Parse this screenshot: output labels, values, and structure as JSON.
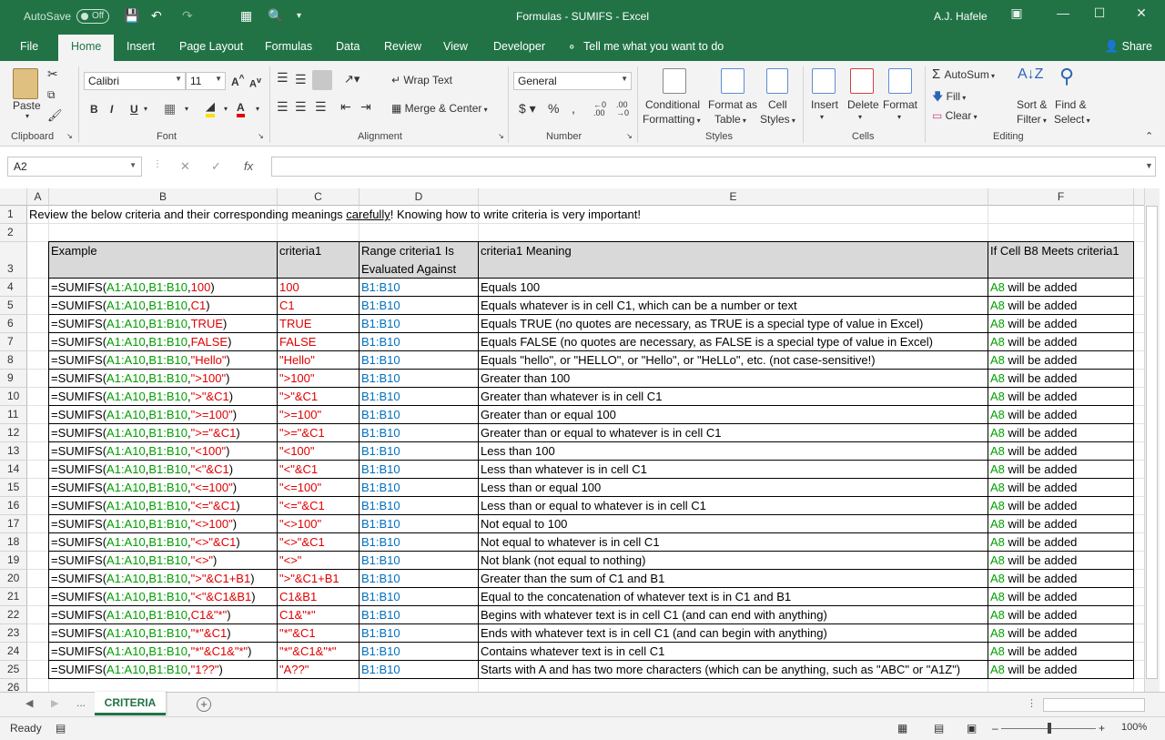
{
  "titlebar": {
    "autosave_label": "AutoSave",
    "autosave_state": "Off",
    "title": "Formulas - SUMIFS  -  Excel",
    "user": "A.J. Hafele"
  },
  "tabs": [
    "File",
    "Home",
    "Insert",
    "Page Layout",
    "Formulas",
    "Data",
    "Review",
    "View",
    "Developer",
    "Tell me what you want to do"
  ],
  "active_tab": "Home",
  "share": "Share",
  "ribbon": {
    "clipboard": {
      "paste": "Paste",
      "label": "Clipboard"
    },
    "font": {
      "name": "Calibri",
      "size": "11",
      "label": "Font"
    },
    "alignment": {
      "wrap": "Wrap Text",
      "merge": "Merge & Center",
      "label": "Alignment"
    },
    "number": {
      "format": "General",
      "label": "Number"
    },
    "styles": {
      "conditional": "Conditional",
      "formatting": "Formatting",
      "format_as": "Format as",
      "table": "Table",
      "cell": "Cell",
      "styles": "Styles",
      "label": "Styles"
    },
    "cells": {
      "insert": "Insert",
      "delete": "Delete",
      "format": "Format",
      "label": "Cells"
    },
    "editing": {
      "autosum": "AutoSum",
      "fill": "Fill",
      "clear": "Clear",
      "sort": "Sort &",
      "filter": "Filter",
      "find": "Find &",
      "select": "Select",
      "label": "Editing"
    }
  },
  "namebox": "A2",
  "formula": "",
  "columns": [
    "A",
    "B",
    "C",
    "D",
    "E",
    "F"
  ],
  "row1": {
    "before": "Review the below criteria and their corresponding meanings ",
    "underlined": "carefully",
    "after": "!  Knowing how to write criteria is very important!"
  },
  "header": {
    "example": "Example",
    "criteria": "criteria1",
    "range1": "Range criteria1 Is",
    "range2": "Evaluated Against",
    "meaning": "criteria1 Meaning",
    "if": "If Cell B8 Meets criteria1"
  },
  "rows": [
    {
      "crit": "100",
      "crit_display": "100",
      "meaning": "Equals 100"
    },
    {
      "crit": "C1",
      "crit_display": "C1",
      "meaning": "Equals whatever is in cell C1, which can be a number or text"
    },
    {
      "crit": "TRUE",
      "crit_display": "TRUE",
      "meaning": "Equals TRUE (no quotes are necessary, as TRUE is a special type of value in Excel)"
    },
    {
      "crit": "FALSE",
      "crit_display": "FALSE",
      "meaning": "Equals FALSE (no quotes are necessary, as FALSE is a special type of value in Excel)"
    },
    {
      "crit": "\"Hello\"",
      "crit_display": "\"Hello\"",
      "meaning": "Equals \"hello\", or \"HELLO\", or \"Hello\", or \"HeLLo\", etc. (not case-sensitive!)"
    },
    {
      "crit": "\">100\"",
      "crit_display": "\">100\"",
      "meaning": "Greater than 100"
    },
    {
      "crit": "\">\"&C1",
      "crit_display": "\">\"&C1",
      "meaning": "Greater than whatever is in cell C1"
    },
    {
      "crit": "\">=100\"",
      "crit_display": "\">=100\"",
      "meaning": "Greater than or equal 100"
    },
    {
      "crit": "\">=\"&C1",
      "crit_display": "\">=\"&C1",
      "meaning": "Greater than or equal to whatever is in cell C1"
    },
    {
      "crit": "\"<100\"",
      "crit_display": "\"<100\"",
      "meaning": "Less than 100"
    },
    {
      "crit": "\"<\"&C1",
      "crit_display": "\"<\"&C1",
      "meaning": "Less than whatever is in cell C1"
    },
    {
      "crit": "\"<=100\"",
      "crit_display": "\"<=100\"",
      "meaning": "Less than or equal 100"
    },
    {
      "crit": "\"<=\"&C1",
      "crit_display": "\"<=\"&C1",
      "meaning": "Less than or equal to whatever is in cell C1"
    },
    {
      "crit": "\"<>100\"",
      "crit_display": "\"<>100\"",
      "meaning": "Not equal to 100"
    },
    {
      "crit": "\"<>\"&C1",
      "crit_display": "\"<>\"&C1",
      "meaning": "Not equal to whatever is in cell C1"
    },
    {
      "crit": "\"<>\"",
      "crit_display": "\"<>\"",
      "meaning": "Not blank (not equal to nothing)"
    },
    {
      "crit": "\">\"&C1+B1",
      "crit_display": "\">\"&C1+B1",
      "meaning": "Greater than the sum of C1 and B1"
    },
    {
      "crit": "\"<\"&C1&B1",
      "crit_display": "C1&B1",
      "meaning": "Equal to the concatenation of whatever text is in C1 and B1"
    },
    {
      "crit": "C1&\"*\"",
      "crit_display": "C1&\"*\"",
      "meaning": "Begins with whatever text is in cell C1 (and can end with anything)"
    },
    {
      "crit": "\"*\"&C1",
      "crit_display": "\"*\"&C1",
      "meaning": "Ends with whatever text is in cell C1 (and can begin with anything)"
    },
    {
      "crit": "\"*\"&C1&\"*\"",
      "crit_display": "\"*\"&C1&\"*\"",
      "meaning": "Contains whatever text is in cell C1"
    },
    {
      "crit": "\"1??\"",
      "crit_display": "\"A??\"",
      "meaning": "Starts with A and has two more characters (which can be anything, such as \"ABC\" or \"A1Z\")"
    }
  ],
  "formula_parts": {
    "prefix": "=SUMIFS(",
    "range_a": "A1:A10",
    "comma": ",",
    "range_b": "B1:B10",
    "suffix": ")"
  },
  "range_text": "B1:B10",
  "result": {
    "ref": "A8",
    "text": " will be added"
  },
  "sheet_tab": "CRITERIA",
  "sheet_more": "...",
  "status": {
    "ready": "Ready",
    "zoom": "100%"
  },
  "colors": {
    "green": "#00a000",
    "red": "#e00000",
    "blue": "#0070c0",
    "brand": "#217346"
  }
}
